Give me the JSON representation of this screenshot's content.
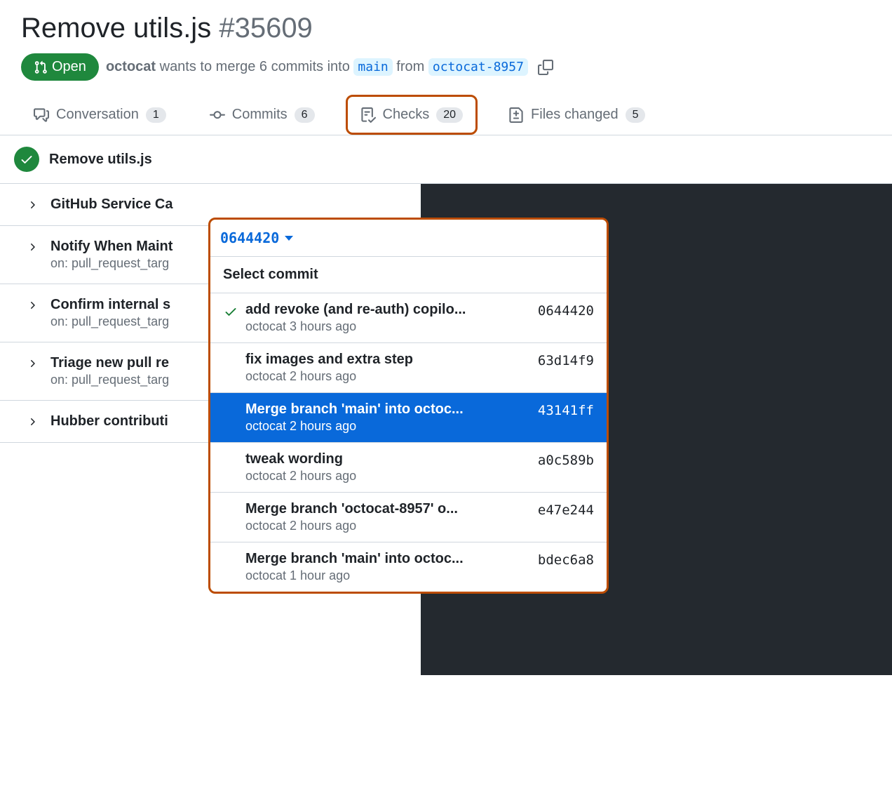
{
  "pr": {
    "title": "Remove utils.js",
    "number": "#35609",
    "state": "Open",
    "author": "octocat",
    "description_part1": " wants to merge 6 commits into ",
    "base_branch": "main",
    "description_part2": " from ",
    "head_branch": "octocat-8957"
  },
  "tabs": {
    "conversation": {
      "label": "Conversation",
      "count": "1"
    },
    "commits": {
      "label": "Commits",
      "count": "6"
    },
    "checks": {
      "label": "Checks",
      "count": "20"
    },
    "files": {
      "label": "Files changed",
      "count": "5"
    }
  },
  "checks_header": {
    "title": "Remove utils.js",
    "commit_sha": "0644420"
  },
  "check_runs": [
    {
      "title": "GitHub Service Ca",
      "subtitle": ""
    },
    {
      "title": "Notify When Maint",
      "subtitle": "on: pull_request_targ"
    },
    {
      "title": "Confirm internal s",
      "subtitle": "on: pull_request_targ"
    },
    {
      "title": "Triage new pull re",
      "subtitle": "on: pull_request_targ"
    },
    {
      "title": "Hubber contributi",
      "subtitle": ""
    }
  ],
  "dropdown": {
    "title": "Select commit",
    "commits": [
      {
        "message": "add revoke (and re-auth) copilo...",
        "meta": "octocat 3 hours ago",
        "sha": "0644420",
        "current": true,
        "selected": false
      },
      {
        "message": "fix images and extra step",
        "meta": "octocat 2 hours ago",
        "sha": "63d14f9",
        "current": false,
        "selected": false
      },
      {
        "message": "Merge branch 'main' into octoc...",
        "meta": "octocat 2 hours ago",
        "sha": "43141ff",
        "current": false,
        "selected": true
      },
      {
        "message": "tweak wording",
        "meta": "octocat 2 hours ago",
        "sha": "a0c589b",
        "current": false,
        "selected": false
      },
      {
        "message": "Merge branch 'octocat-8957' o...",
        "meta": "octocat 2 hours ago",
        "sha": "e47e244",
        "current": false,
        "selected": false
      },
      {
        "message": "Merge branch 'main' into octoc...",
        "meta": "octocat 1 hour ago",
        "sha": "bdec6a8",
        "current": false,
        "selected": false
      }
    ]
  }
}
